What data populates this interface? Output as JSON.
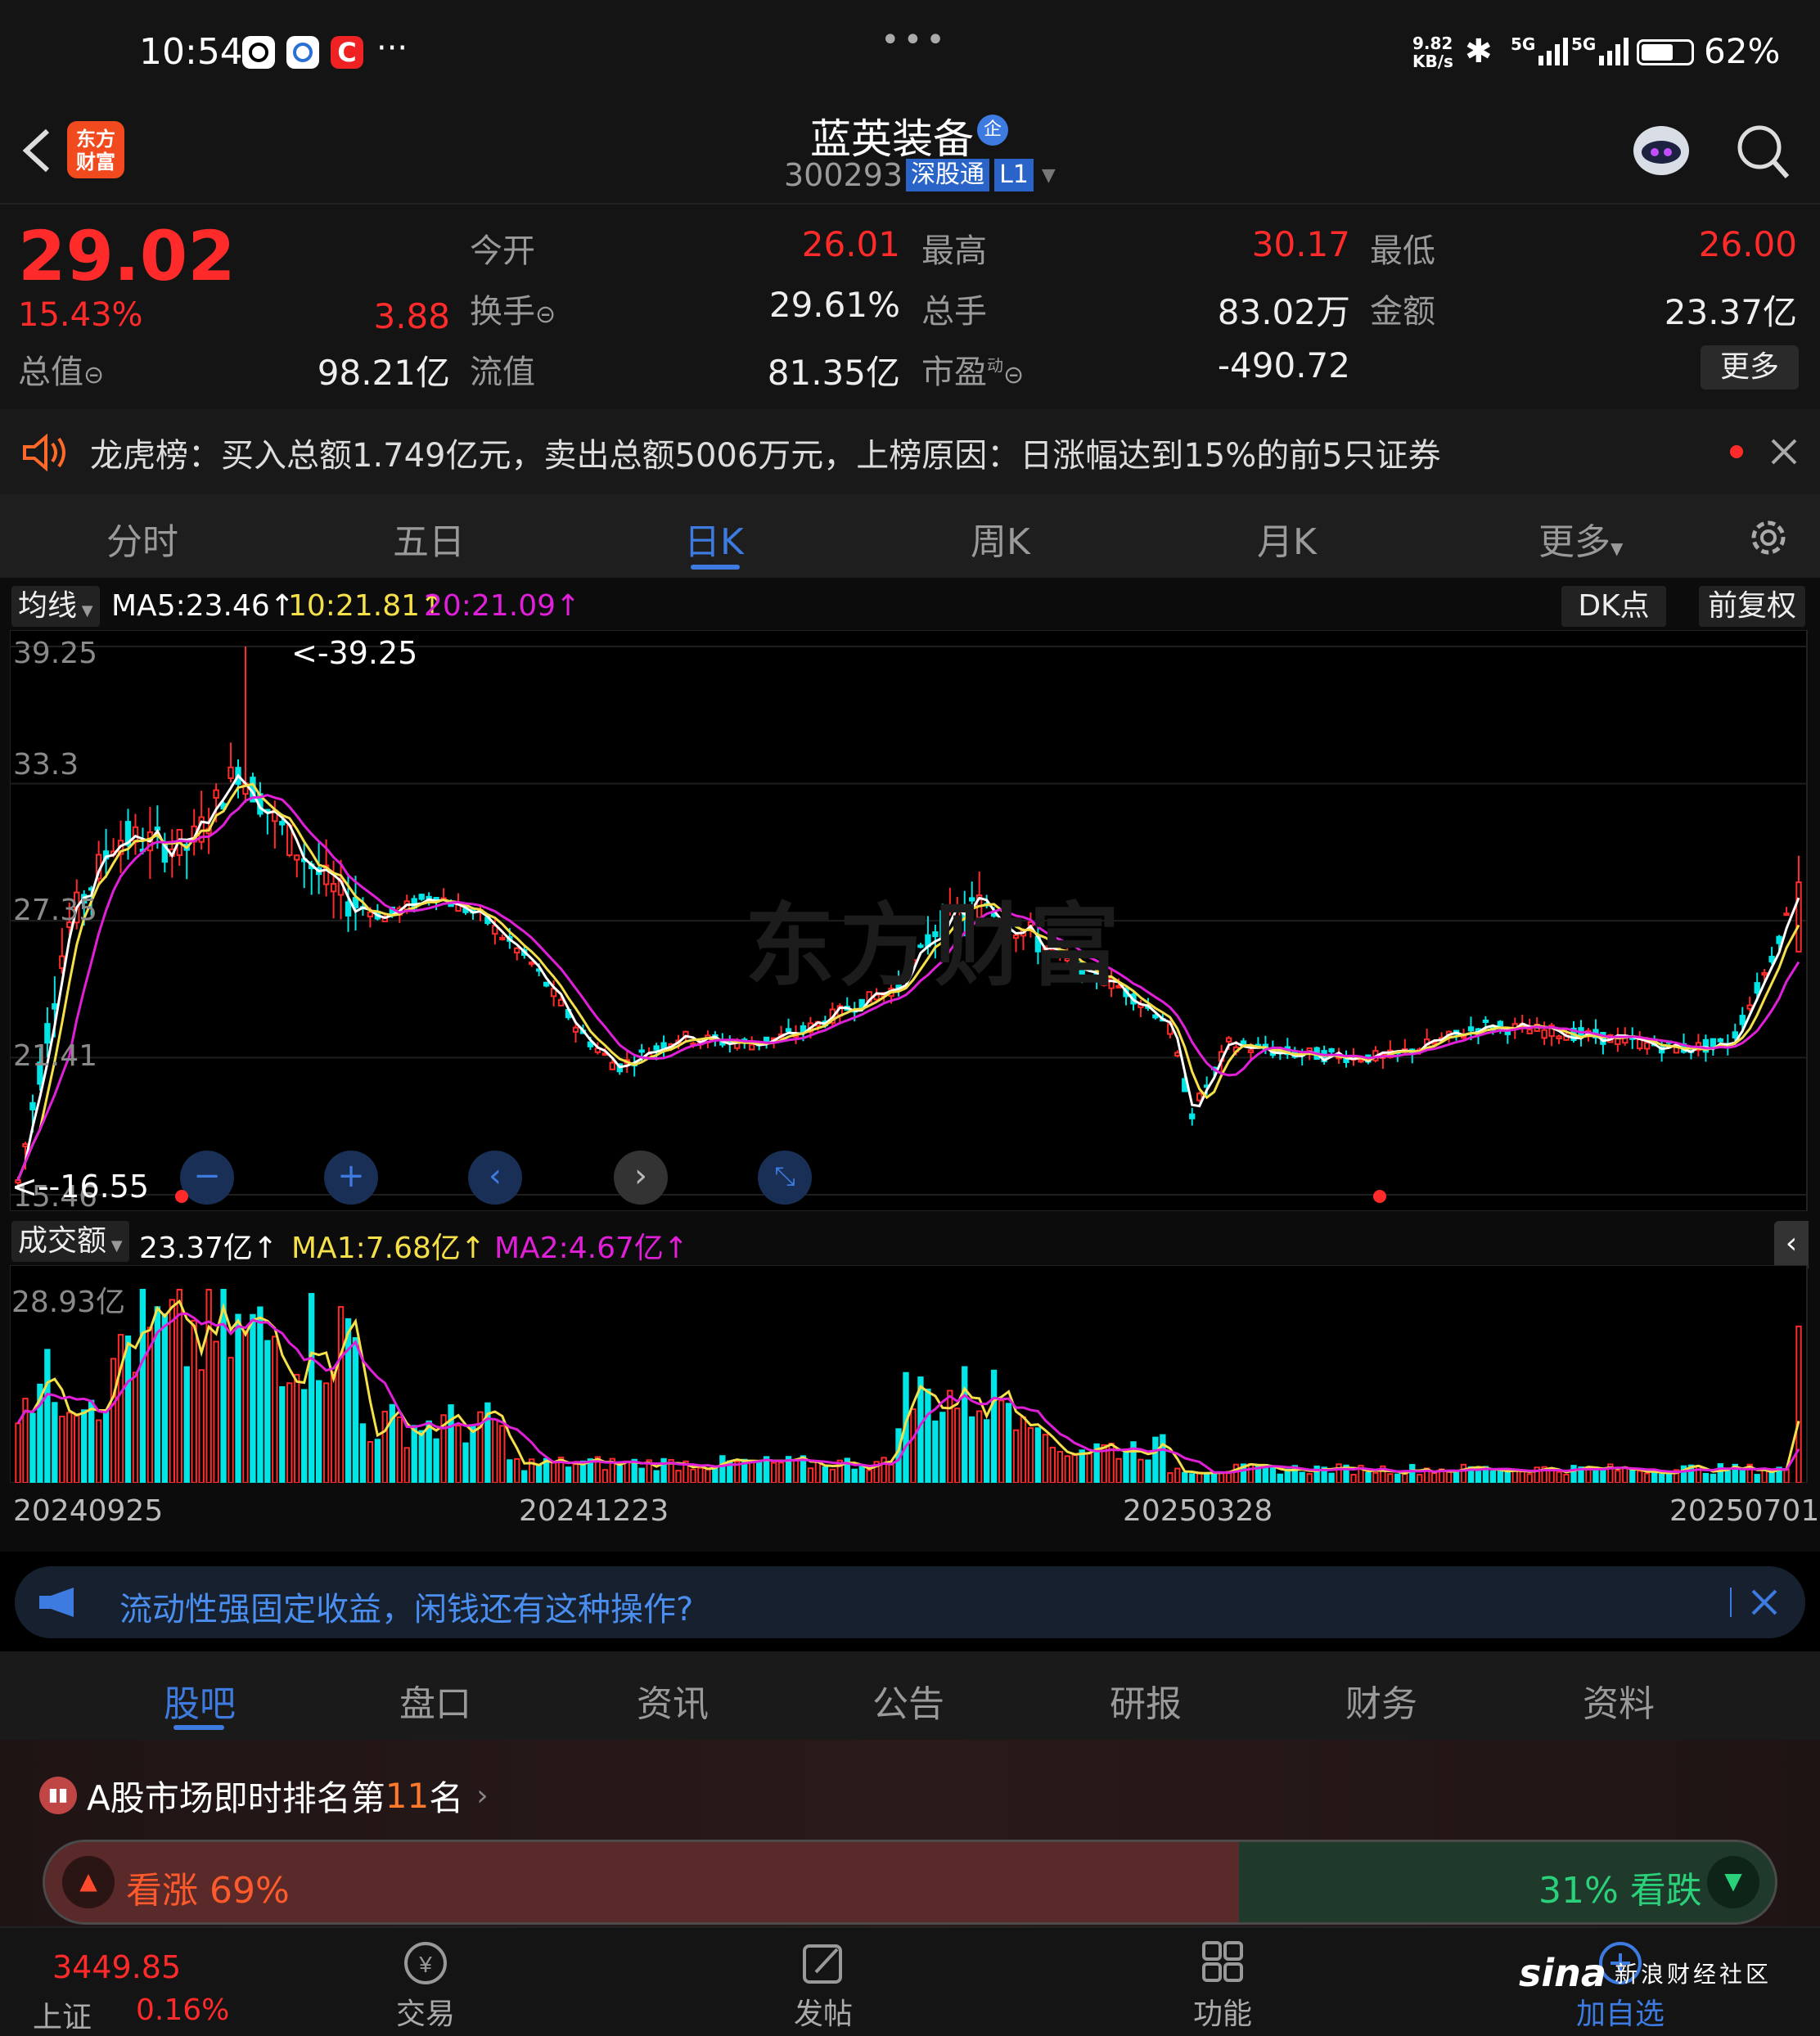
{
  "status": {
    "time": "10:54",
    "more": "···",
    "center_dots": "•••",
    "net_speed_top": "9.82",
    "net_speed_bottom": "KB/s",
    "sig1": "5G",
    "sig2": "5G",
    "battery": "62%"
  },
  "header": {
    "logo_line1": "东方",
    "logo_line2": "财富",
    "name": "蓝英装备",
    "badge": "企",
    "code": "300293",
    "tag1": "深股通",
    "tag2": "L1"
  },
  "quote": {
    "price": "29.02",
    "pct": "15.43%",
    "chg": "3.88",
    "open_label": "今开",
    "open": "26.01",
    "high_label": "最高",
    "high": "30.17",
    "low_label": "最低",
    "low": "26.00",
    "turnover_label": "换手",
    "turnover": "29.61%",
    "vol_label": "总手",
    "vol": "83.02万",
    "amount_label": "金额",
    "amount": "23.37亿",
    "mcap_label": "总值",
    "mcap": "98.21亿",
    "float_label": "流值",
    "float": "81.35亿",
    "pe_label": "市盈",
    "pe_sup": "动",
    "pe": "-490.72",
    "more": "更多"
  },
  "notice": {
    "text": "龙虎榜：买入总额1.749亿元，卖出总额5006万元，上榜原因：日涨幅达到15%的前5只证券"
  },
  "period_tabs": [
    "分时",
    "五日",
    "日K",
    "周K",
    "月K",
    "更多"
  ],
  "chart": {
    "ma_selector": "均线",
    "ma5": "MA5:23.46",
    "ma10": "10:21.81",
    "ma20": "20:21.09",
    "dk": "DK点",
    "adjust": "前复权",
    "max_marker": "<-39.25",
    "min_marker": "<--16.55",
    "vol_selector": "成交额",
    "vol_val": "23.37亿",
    "vma1": "MA1:7.68亿",
    "vma2": "MA2:4.67亿",
    "vol_max": "28.93亿",
    "dates": [
      "20240925",
      "20241223",
      "20250328",
      "20250701"
    ],
    "watermark": "东方财富"
  },
  "chart_data": {
    "type": "candlestick",
    "y_ticks": [
      39.25,
      33.3,
      27.35,
      21.41,
      15.46
    ],
    "ylim": [
      15.46,
      39.25
    ],
    "high_point": 39.25,
    "low_point": 16.55,
    "last_close": 29.02,
    "last_open": 26.01,
    "last_high": 30.17,
    "last_low": 26.0,
    "ma5": 23.46,
    "ma10": 21.81,
    "ma20": 21.09,
    "volume_max": "28.93亿",
    "volume_last": "23.37亿",
    "volume_ma1": "7.68亿",
    "volume_ma2": "4.67亿",
    "x_labels": [
      "20240925",
      "20241223",
      "20250328",
      "20250701"
    ]
  },
  "ad": {
    "text": "流动性强固定收益，闲钱还有这种操作?"
  },
  "sub_tabs": [
    "股吧",
    "盘口",
    "资讯",
    "公告",
    "研报",
    "财务",
    "资料"
  ],
  "rank": {
    "prefix": "A股市场即时排名第",
    "num": "11",
    "suffix": "名",
    "bull": "看涨 69%",
    "bear": "31% 看跌",
    "bull_ratio": 0.69
  },
  "bottom": {
    "index_val": "3449.85",
    "index_name": "上证",
    "index_pct": "0.16%",
    "trade": "交易",
    "post": "发帖",
    "func": "功能",
    "add": "加自选",
    "sina": "sina",
    "sina_txt": "新浪财经社区"
  },
  "colors": {
    "up": "#ff2b2b",
    "down": "#00e5e5",
    "ma5": "#ffffff",
    "ma10": "#f5e04a",
    "ma20": "#e020d8",
    "accent": "#3e7be0"
  }
}
